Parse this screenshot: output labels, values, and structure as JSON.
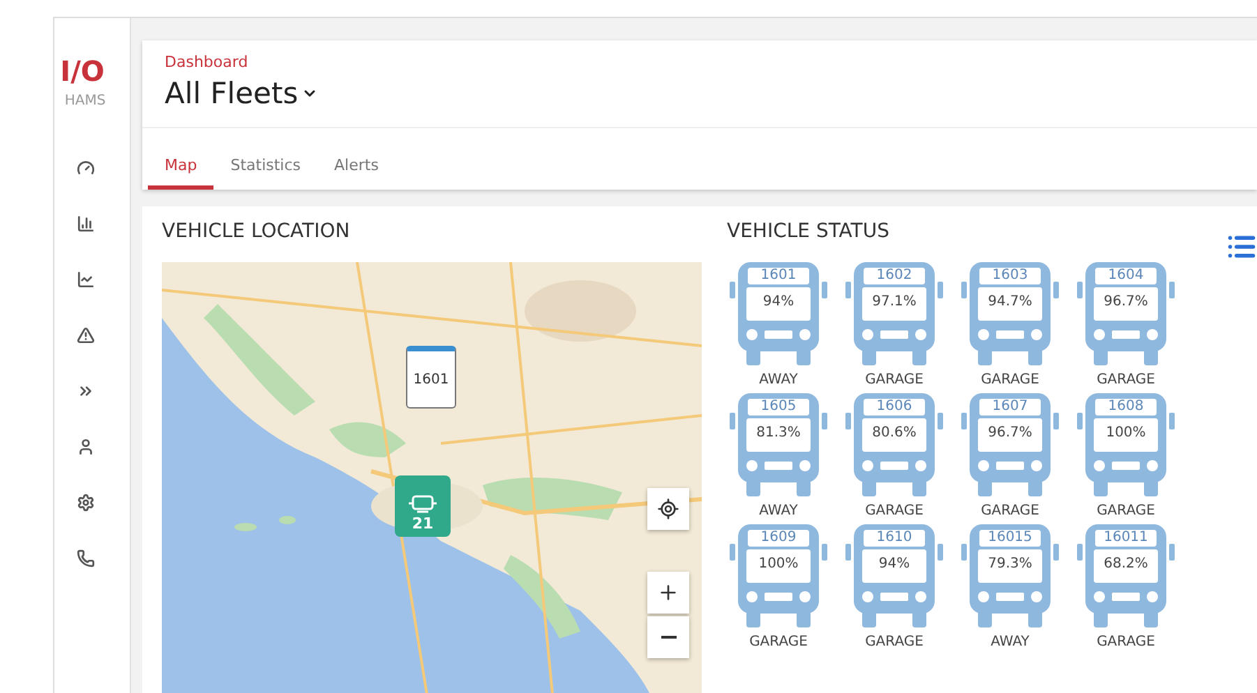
{
  "brand": {
    "logo": "I/O",
    "subtitle": "HAMS"
  },
  "sidebar": {
    "items": [
      {
        "kind": "gauge"
      },
      {
        "kind": "bars"
      },
      {
        "kind": "line"
      },
      {
        "kind": "alert"
      },
      {
        "kind": "expand"
      },
      {
        "kind": "user"
      },
      {
        "kind": "settings"
      },
      {
        "kind": "phone"
      }
    ]
  },
  "header": {
    "breadcrumb": "Dashboard",
    "title": "All Fleets"
  },
  "tabs": [
    {
      "label": "Map",
      "selected": true
    },
    {
      "label": "Statistics",
      "selected": false
    },
    {
      "label": "Alerts",
      "selected": false
    }
  ],
  "location": {
    "title": "VEHICLE LOCATION",
    "map": {
      "marker": "1601",
      "cluster": "21"
    }
  },
  "status": {
    "title": "VEHICLE STATUS",
    "vehicles": [
      {
        "id": "1601",
        "charge": "94%",
        "state": "AWAY"
      },
      {
        "id": "1602",
        "charge": "97.1%",
        "state": "GARAGE"
      },
      {
        "id": "1603",
        "charge": "94.7%",
        "state": "GARAGE"
      },
      {
        "id": "1604",
        "charge": "96.7%",
        "state": "GARAGE"
      },
      {
        "id": "1605",
        "charge": "81.3%",
        "state": "AWAY"
      },
      {
        "id": "1606",
        "charge": "80.6%",
        "state": "GARAGE"
      },
      {
        "id": "1607",
        "charge": "96.7%",
        "state": "GARAGE"
      },
      {
        "id": "1608",
        "charge": "100%",
        "state": "GARAGE"
      },
      {
        "id": "1609",
        "charge": "100%",
        "state": "GARAGE"
      },
      {
        "id": "1610",
        "charge": "94%",
        "state": "GARAGE"
      },
      {
        "id": "16015",
        "charge": "79.3%",
        "state": "AWAY"
      },
      {
        "id": "16011",
        "charge": "68.2%",
        "state": "GARAGE"
      }
    ]
  }
}
